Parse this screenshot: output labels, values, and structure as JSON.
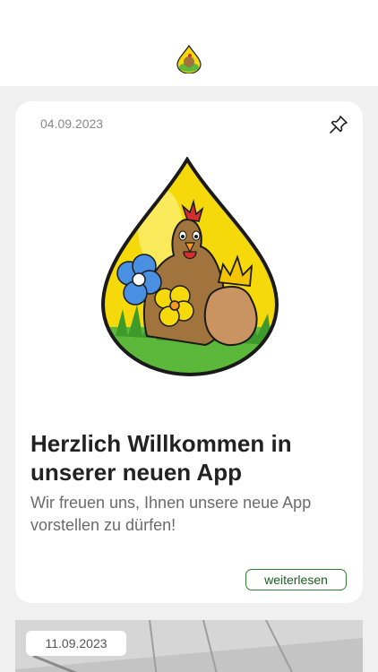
{
  "header": {
    "logo_icon": "chicken-drop-logo-icon"
  },
  "posts": [
    {
      "date": "04.09.2023",
      "pin_icon": "pin-icon",
      "image_icon": "chicken-drop-illustration",
      "title": "Herzlich Willkommen in unserer neuen App",
      "teaser": "Wir freuen uns, Ihnen unsere neue App vorstellen zu dürfen!",
      "more_label": "weiterlesen"
    },
    {
      "date": "11.09.2023"
    }
  ],
  "colors": {
    "accent": "#2e7d32",
    "background": "#f0f0f0",
    "card": "#ffffff",
    "drop_yellow": "#f5d90a",
    "grass": "#5cb83a"
  }
}
